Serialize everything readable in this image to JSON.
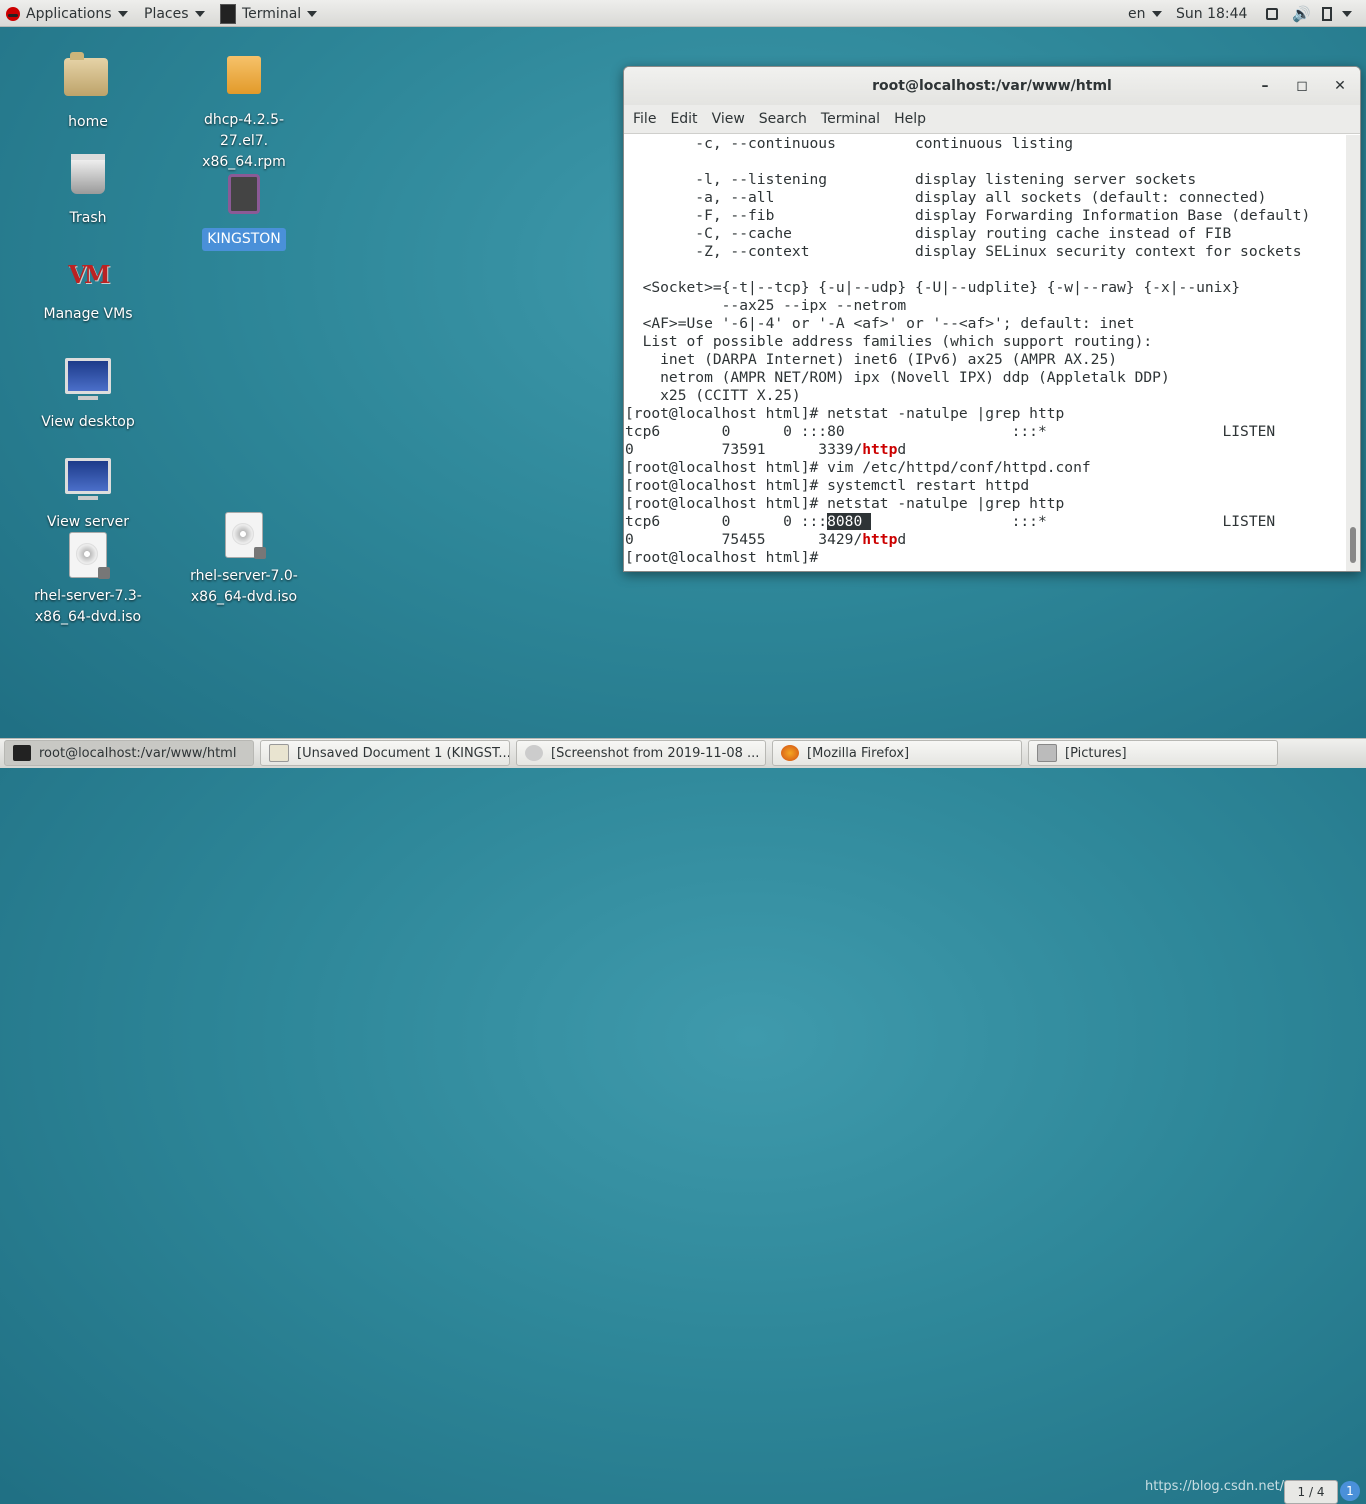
{
  "top_panel": {
    "applications": "Applications",
    "places": "Places",
    "terminal": "Terminal",
    "lang": "en",
    "clock": "Sun 18:44"
  },
  "desktop": {
    "icons": [
      {
        "label": "home"
      },
      {
        "label": "dhcp-4.2.5-27.el7.\nx86_64.rpm"
      },
      {
        "label": "Trash"
      },
      {
        "label": "KINGSTON"
      },
      {
        "label": "Manage VMs"
      },
      {
        "label": "View desktop"
      },
      {
        "label": "View server"
      },
      {
        "label": "rhel-server-7.3-\nx86_64-dvd.iso"
      },
      {
        "label": "rhel-server-7.0-\nx86_64-dvd.iso"
      }
    ]
  },
  "window": {
    "title": "root@localhost:/var/www/html",
    "menu": [
      "File",
      "Edit",
      "View",
      "Search",
      "Terminal",
      "Help"
    ]
  },
  "terminal": {
    "lines": [
      "        -c, --continuous         continuous listing",
      "",
      "        -l, --listening          display listening server sockets",
      "        -a, --all                display all sockets (default: connected)",
      "        -F, --fib                display Forwarding Information Base (default)",
      "        -C, --cache              display routing cache instead of FIB",
      "        -Z, --context            display SELinux security context for sockets",
      "",
      "  <Socket>={-t|--tcp} {-u|--udp} {-U|--udplite} {-w|--raw} {-x|--unix}",
      "           --ax25 --ipx --netrom",
      "  <AF>=Use '-6|-4' or '-A <af>' or '--<af>'; default: inet",
      "  List of possible address families (which support routing):",
      "    inet (DARPA Internet) inet6 (IPv6) ax25 (AMPR AX.25)",
      "    netrom (AMPR NET/ROM) ipx (Novell IPX) ddp (Appletalk DDP)",
      "    x25 (CCITT X.25)",
      "[root@localhost html]# netstat -natulpe |grep http",
      "tcp6       0      0 :::80                   :::*                    LISTEN",
      "0          73591      3339/",
      "[root@localhost html]# vim /etc/httpd/conf/httpd.conf",
      "[root@localhost html]# systemctl restart httpd",
      "[root@localhost html]# netstat -natulpe |grep http",
      "tcp6       0      0 :::",
      "0          75455      3429/",
      "[root@localhost html]# "
    ],
    "http_red": "http",
    "http_rest": "d",
    "port_selected": "8080 ",
    "line21_rest": "                :::*                    LISTEN"
  },
  "taskbar": {
    "tasks": [
      "root@localhost:/var/www/html",
      "[Unsaved Document 1 (KINGST...",
      "[Screenshot from 2019-11-08 ...",
      "[Mozilla Firefox]",
      "[Pictures]"
    ],
    "watermark": "https://blog.csdn.net/csrisal",
    "pager": "1 / 4",
    "notification_count": "1"
  }
}
